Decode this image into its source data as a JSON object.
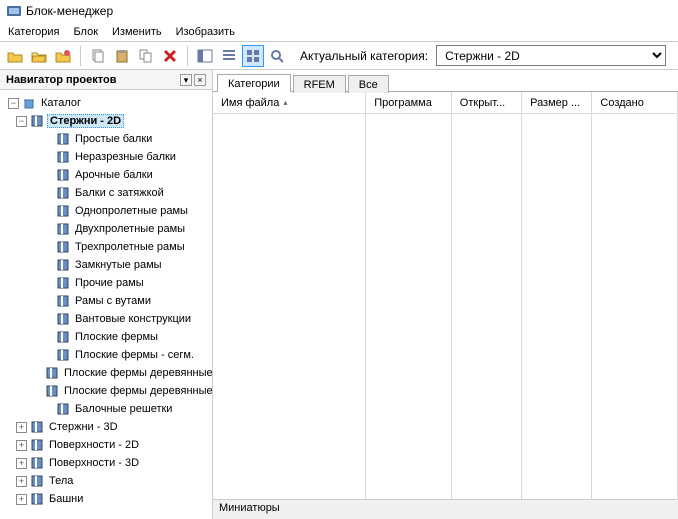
{
  "title": "Блок-менеджер",
  "menu": {
    "cat": "Категория",
    "block": "Блок",
    "edit": "Изменить",
    "disp": "Изобразить"
  },
  "toolbar": {
    "cat_label": "Актуальный категория:",
    "cat_value": "Стержни - 2D"
  },
  "sidebar": {
    "title": "Навигатор проектов",
    "root": "Каталог",
    "selected": "Стержни - 2D",
    "leaves": [
      "Простые балки",
      "Неразрезные балки",
      "Арочные балки",
      "Балки с затяжкой",
      "Однопролетные рамы",
      "Двухпролетные рамы",
      "Трехпролетные рамы",
      "Замкнутые рамы",
      "Прочие рамы",
      "Рамы с вутами",
      "Вантовые конструкции",
      "Плоские фермы",
      "Плоские фермы - сегм.",
      "Плоские фермы деревянные",
      "Плоские фермы деревянные",
      "Балочные решетки"
    ],
    "siblings": [
      "Стержни - 3D",
      "Поверхности - 2D",
      "Поверхности - 3D",
      "Тела",
      "Башни"
    ]
  },
  "tabs": {
    "t0": "Категории",
    "t1": "RFEM",
    "t2": "Все"
  },
  "cols": {
    "c0": "Имя файла",
    "c1": "Программа",
    "c2": "Открыт...",
    "c3": "Размер ...",
    "c4": "Создано"
  },
  "thumbs": "Миниатюры"
}
